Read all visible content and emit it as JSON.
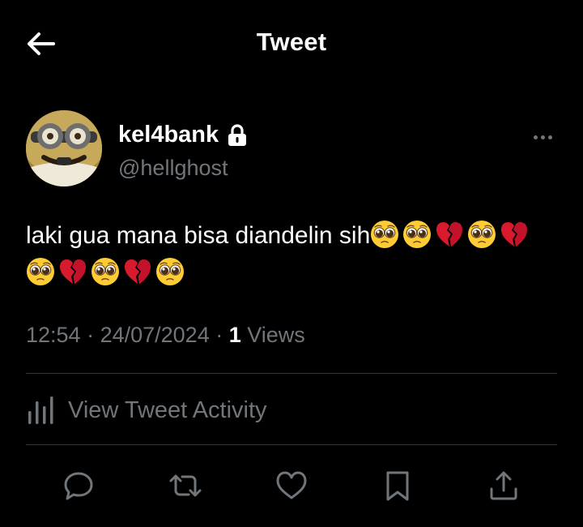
{
  "header": {
    "title": "Tweet",
    "back_icon": "arrow-left-icon"
  },
  "author": {
    "display_name": "kel4bank",
    "handle": "@hellghost",
    "protected_icon": "lock-icon",
    "avatar": "minion-avatar",
    "more_icon": "more-horizontal-icon"
  },
  "tweet": {
    "text": "laki gua mana bisa diandelin sih",
    "emojis": [
      "pleading-face",
      "pleading-face",
      "broken-heart",
      "pleading-face",
      "broken-heart",
      "pleading-face",
      "broken-heart",
      "pleading-face",
      "broken-heart",
      "pleading-face"
    ]
  },
  "meta": {
    "time": "12:54",
    "sep1": " · ",
    "date": "24/07/2024",
    "sep2": " · ",
    "views_count": "1",
    "views_label": " Views"
  },
  "activity": {
    "label": "View Tweet Activity",
    "icon": "bar-chart-icon"
  },
  "actions": [
    "reply-icon",
    "retweet-icon",
    "like-icon",
    "bookmark-icon",
    "share-icon"
  ],
  "colors": {
    "background": "#000000",
    "text_primary": "#ffffff",
    "text_secondary": "#71767b",
    "divider": "#2f3336",
    "icon": "#71767b"
  }
}
